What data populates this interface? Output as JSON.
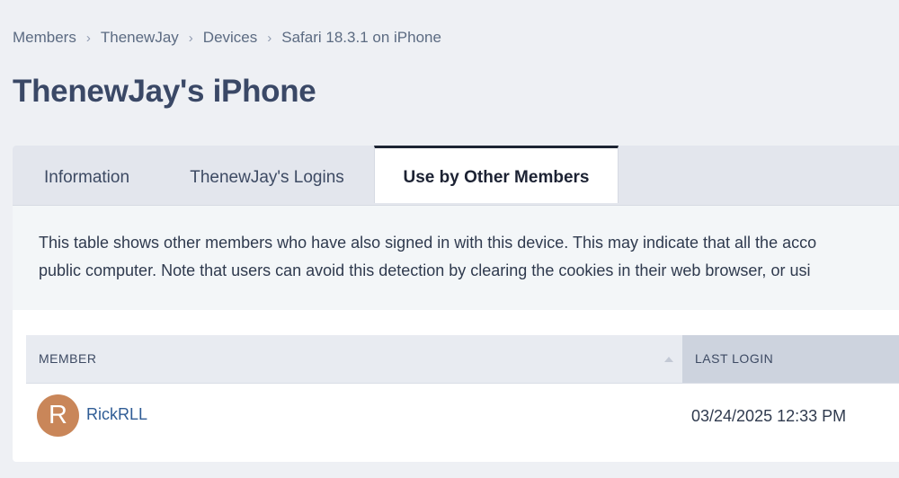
{
  "breadcrumb": {
    "items": [
      "Members",
      "ThenewJay",
      "Devices",
      "Safari 18.3.1 on iPhone"
    ],
    "separator": "›"
  },
  "page_title": "ThenewJay's iPhone",
  "tabs": [
    {
      "label": "Information",
      "active": false
    },
    {
      "label": "ThenewJay's Logins",
      "active": false
    },
    {
      "label": "Use by Other Members",
      "active": true
    }
  ],
  "notice": {
    "line1": "This table shows other members who have also signed in with this device. This may indicate that all the acco",
    "line2": "public computer. Note that users can avoid this detection by clearing the cookies in their web browser, or usi"
  },
  "table": {
    "columns": [
      "MEMBER",
      "LAST LOGIN"
    ],
    "rows": [
      {
        "avatar_letter": "R",
        "avatar_color": "#c98659",
        "member": "RickRLL",
        "last_login": "03/24/2025 12:33 PM"
      }
    ]
  },
  "colors": {
    "background": "#eef0f4",
    "title": "#3a4866",
    "link": "#2f5c95",
    "active_tab_border": "#1d2433",
    "sorted_header": "#cdd3de"
  }
}
